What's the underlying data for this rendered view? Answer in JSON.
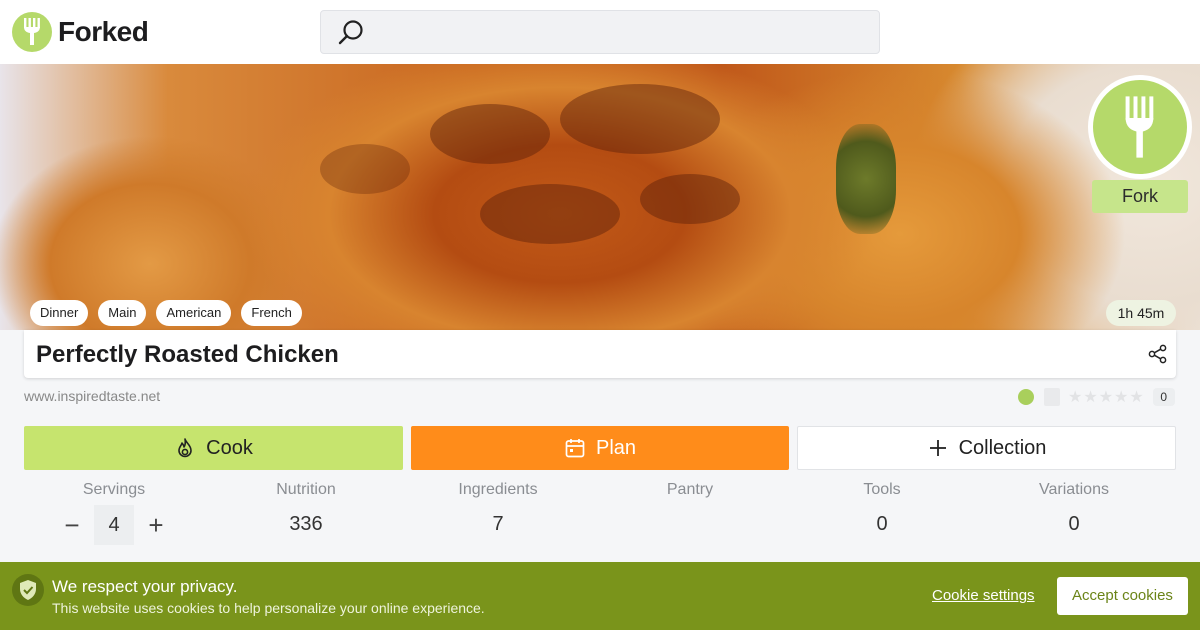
{
  "header": {
    "logo_text": "Forked",
    "search_placeholder": ""
  },
  "hero": {
    "fork_label": "Fork",
    "tags": [
      "Dinner",
      "Main",
      "American",
      "French"
    ],
    "total_time": "1h 45m"
  },
  "recipe": {
    "title": "Perfectly Roasted Chicken",
    "source": "www.inspiredtaste.net",
    "rating_stars": 0,
    "rating_count": "0"
  },
  "actions": {
    "cook_label": "Cook",
    "plan_label": "Plan",
    "collection_label": "Collection"
  },
  "stats": {
    "servings_label": "Servings",
    "servings_value": "4",
    "nutrition_label": "Nutrition",
    "nutrition_value": "336",
    "ingredients_label": "Ingredients",
    "ingredients_value": "7",
    "pantry_label": "Pantry",
    "pantry_value": "",
    "tools_label": "Tools",
    "tools_value": "0",
    "variations_label": "Variations",
    "variations_value": "0"
  },
  "cookie_banner": {
    "title": "We respect your privacy.",
    "message": "This website uses cookies to help personalize your online experience.",
    "settings_label": "Cookie settings",
    "accept_label": "Accept cookies"
  },
  "colors": {
    "brand_green": "#b5d96a",
    "cook_green": "#c6e46e",
    "plan_orange": "#ff8c1a",
    "cookie_bar": "#7a941b"
  }
}
